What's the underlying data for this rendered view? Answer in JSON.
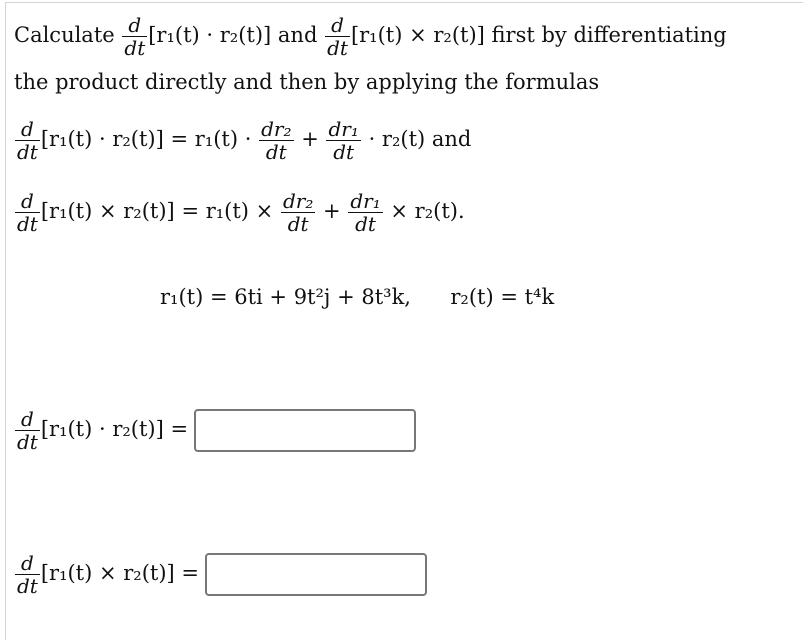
{
  "intro": {
    "word_calculate": "Calculate",
    "deriv_num": "d",
    "deriv_den": "dt",
    "dot_product": "[r₁(t) · r₂(t)]",
    "word_and": "and",
    "cross_product": "[r₁(t) × r₂(t)]",
    "tail_line1": "first by differentiating",
    "line2": "the product directly and then by applying the formulas"
  },
  "formulas": {
    "dot_rule": {
      "lhs": "[r₁(t) · r₂(t)]",
      "rhs_prefix": "= r₁(t) ·",
      "frac1_num": "dr₂",
      "frac1_den": "dt",
      "plus": "+",
      "frac2_num": "dr₁",
      "frac2_den": "dt",
      "rhs_suffix": "· r₂(t)",
      "trailing": "and"
    },
    "cross_rule": {
      "lhs": "[r₁(t) × r₂(t)]",
      "rhs_prefix": "= r₁(t) ×",
      "frac1_num": "dr₂",
      "frac1_den": "dt",
      "plus": "+",
      "frac2_num": "dr₁",
      "frac2_den": "dt",
      "rhs_suffix": "× r₂(t)."
    }
  },
  "given": {
    "r1": "r₁(t) = 6ti + 9t²j + 8t³k,",
    "r2": "r₂(t) = t⁴k"
  },
  "answers": [
    {
      "label": "[r₁(t) · r₂(t)] =",
      "value": "",
      "placeholder": ""
    },
    {
      "label": "[r₁(t) × r₂(t)] =",
      "value": "",
      "placeholder": ""
    }
  ]
}
